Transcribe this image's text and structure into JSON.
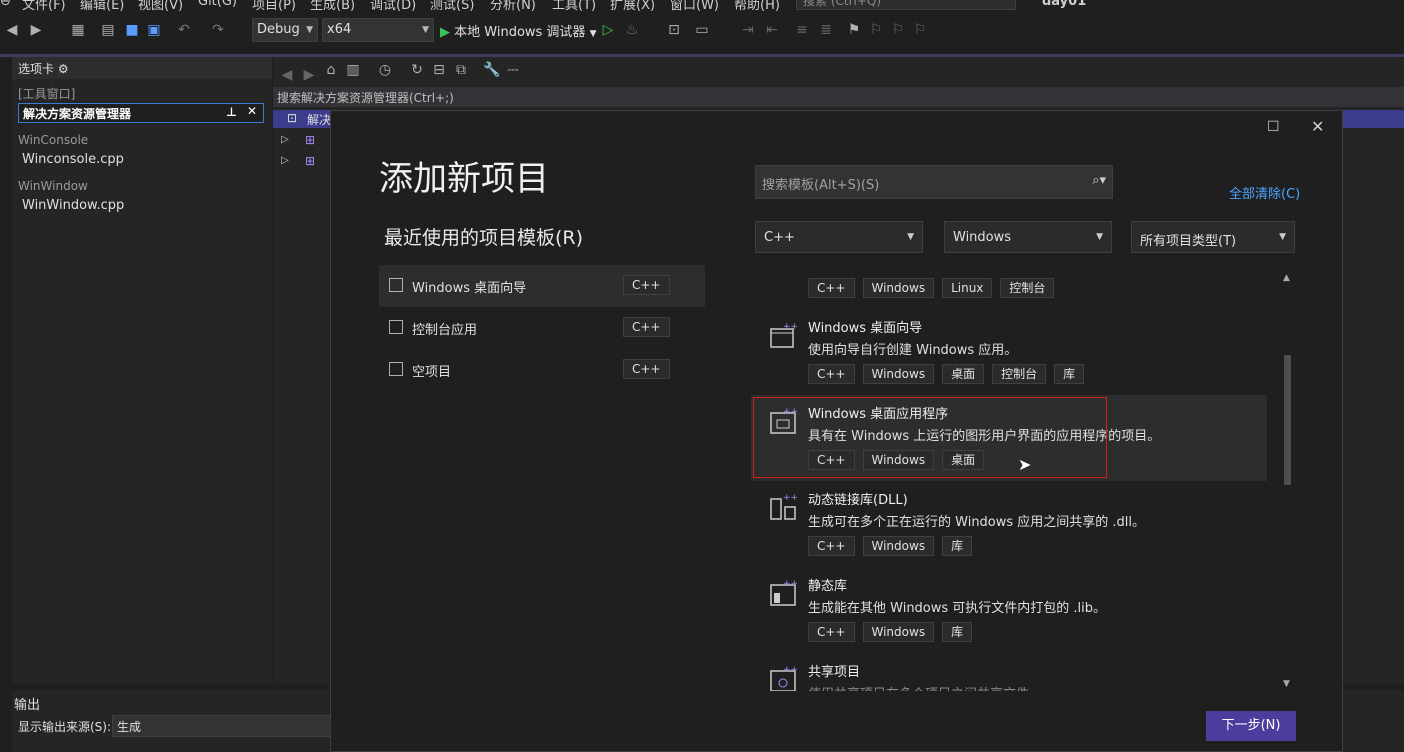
{
  "menubar": {
    "items": [
      "文件(F)",
      "编辑(E)",
      "视图(V)",
      "Git(G)",
      "项目(P)",
      "生成(B)",
      "调试(D)",
      "测试(S)",
      "分析(N)",
      "工具(T)",
      "扩展(X)",
      "窗口(W)",
      "帮助(H)"
    ],
    "search_placeholder": "搜索 (Ctrl+Q)",
    "solution_name": "day01"
  },
  "toolbar": {
    "config": "Debug",
    "platform": "x64",
    "run_label": "本地 Windows 调试器"
  },
  "left_panel": {
    "header": "选项卡",
    "group_label": "[工具窗口]",
    "active_tab": "解决方案资源管理器",
    "projects": [
      {
        "name": "WinConsole",
        "file": "Winconsole.cpp"
      },
      {
        "name": "WinWindow",
        "file": "WinWindow.cpp"
      }
    ]
  },
  "solution_explorer": {
    "search_placeholder": "搜索解决方案资源管理器(Ctrl+;)",
    "row_label": "解决"
  },
  "output": {
    "title": "输出",
    "source_label": "显示输出来源(S):",
    "source_value": "生成"
  },
  "dialog": {
    "title": "添加新项目",
    "recent_title": "最近使用的项目模板(R)",
    "recent_items": [
      {
        "label": "Windows 桌面向导",
        "tag": "C++"
      },
      {
        "label": "控制台应用",
        "tag": "C++"
      },
      {
        "label": "空项目",
        "tag": "C++"
      }
    ],
    "search_placeholder": "搜索模板(Alt+S)(S)",
    "clear_all": "全部清除(C)",
    "filters": {
      "language": "C++",
      "platform": "Windows",
      "project_type": "所有项目类型(T)"
    },
    "top_tags": [
      "C++",
      "Windows",
      "Linux",
      "控制台"
    ],
    "templates": [
      {
        "name": "Windows 桌面向导",
        "desc": "使用向导自行创建 Windows 应用。",
        "tags": [
          "C++",
          "Windows",
          "桌面",
          "控制台",
          "库"
        ],
        "icon": "wizard-icon"
      },
      {
        "name": "Windows 桌面应用程序",
        "desc": "具有在 Windows 上运行的图形用户界面的应用程序的项目。",
        "tags": [
          "C++",
          "Windows",
          "桌面"
        ],
        "icon": "desktop-app-icon"
      },
      {
        "name": "动态链接库(DLL)",
        "desc": "生成可在多个正在运行的 Windows 应用之间共享的 .dll。",
        "tags": [
          "C++",
          "Windows",
          "库"
        ],
        "icon": "dll-icon"
      },
      {
        "name": "静态库",
        "desc": "生成能在其他 Windows 可执行文件内打包的 .lib。",
        "tags": [
          "C++",
          "Windows",
          "库"
        ],
        "icon": "static-lib-icon"
      },
      {
        "name": "共享项目",
        "desc": "使用共享项目在多个项目之间共享文件。",
        "tags": [],
        "icon": "shared-project-icon"
      }
    ],
    "next_button": "下一步(N)"
  },
  "colors": {
    "accent": "#4b3d9c",
    "link": "#4da6ff",
    "highlight": "#d21f1f"
  }
}
